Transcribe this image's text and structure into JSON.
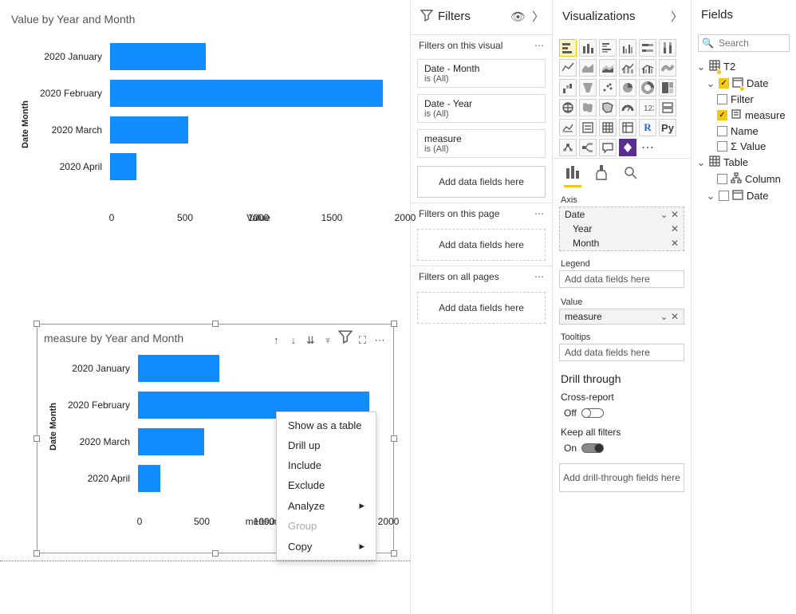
{
  "chart_data": [
    {
      "type": "bar",
      "orientation": "horizontal",
      "title": "Value by Year and Month",
      "ylabel": "Date Month",
      "xlabel": "Value",
      "categories": [
        "2020 January",
        "2020 February",
        "2020 March",
        "2020 April"
      ],
      "values": [
        650,
        1850,
        530,
        180
      ],
      "xlim": [
        0,
        2000
      ],
      "xticks": [
        0,
        500,
        1000,
        1500,
        2000
      ]
    },
    {
      "type": "bar",
      "orientation": "horizontal",
      "title": "measure by Year and Month",
      "ylabel": "Date Month",
      "xlabel": "measure",
      "categories": [
        "2020 January",
        "2020 February",
        "2020 March",
        "2020 April"
      ],
      "values": [
        650,
        1850,
        530,
        180
      ],
      "xlim": [
        0,
        2000
      ],
      "xticks": [
        0,
        500,
        1000,
        1500,
        2000
      ]
    }
  ],
  "context_menu": {
    "items": [
      {
        "label": "Show as a table",
        "enabled": true
      },
      {
        "label": "Drill up",
        "enabled": true
      },
      {
        "label": "Include",
        "enabled": true
      },
      {
        "label": "Exclude",
        "enabled": true
      },
      {
        "label": "Analyze",
        "enabled": true,
        "submenu": true
      },
      {
        "label": "Group",
        "enabled": false
      },
      {
        "label": "Copy",
        "enabled": true,
        "submenu": true
      }
    ]
  },
  "filters": {
    "title": "Filters",
    "sections": {
      "visual": {
        "header": "Filters on this visual",
        "cards": [
          {
            "name": "Date - Month",
            "state": "is (All)"
          },
          {
            "name": "Date - Year",
            "state": "is (All)"
          },
          {
            "name": "measure",
            "state": "is (All)"
          }
        ],
        "drop": "Add data fields here"
      },
      "page": {
        "header": "Filters on this page",
        "drop": "Add data fields here"
      },
      "all": {
        "header": "Filters on all pages",
        "drop": "Add data fields here"
      }
    }
  },
  "visualizations": {
    "title": "Visualizations",
    "wells": {
      "axis": {
        "label": "Axis",
        "field": "Date",
        "hierarchy": [
          "Year",
          "Month"
        ]
      },
      "legend": {
        "label": "Legend",
        "placeholder": "Add data fields here"
      },
      "value": {
        "label": "Value",
        "field": "measure"
      },
      "tooltips": {
        "label": "Tooltips",
        "placeholder": "Add data fields here"
      }
    },
    "drillthrough": {
      "title": "Drill through",
      "cross_report": {
        "label": "Cross-report",
        "value_label": "Off",
        "state": "off"
      },
      "keep_filters": {
        "label": "Keep all filters",
        "value_label": "On",
        "state": "on"
      },
      "drop": "Add drill-through fields here"
    }
  },
  "fields": {
    "title": "Fields",
    "search_placeholder": "Search",
    "tables": [
      {
        "name": "T2",
        "expanded": true,
        "highlighted": true,
        "fields": [
          {
            "name": "Date",
            "type": "date",
            "checked": true,
            "highlighted": true
          },
          {
            "name": "Filter",
            "type": "text",
            "checked": false
          },
          {
            "name": "measure",
            "type": "measure",
            "checked": true
          },
          {
            "name": "Name",
            "type": "text",
            "checked": false
          },
          {
            "name": "Value",
            "type": "sigma",
            "checked": false
          }
        ]
      },
      {
        "name": "Table",
        "expanded": true,
        "highlighted": false,
        "fields": [
          {
            "name": "Column",
            "type": "text",
            "checked": false,
            "hier": true
          },
          {
            "name": "Date",
            "type": "date",
            "checked": false,
            "hier": true
          }
        ]
      }
    ]
  }
}
